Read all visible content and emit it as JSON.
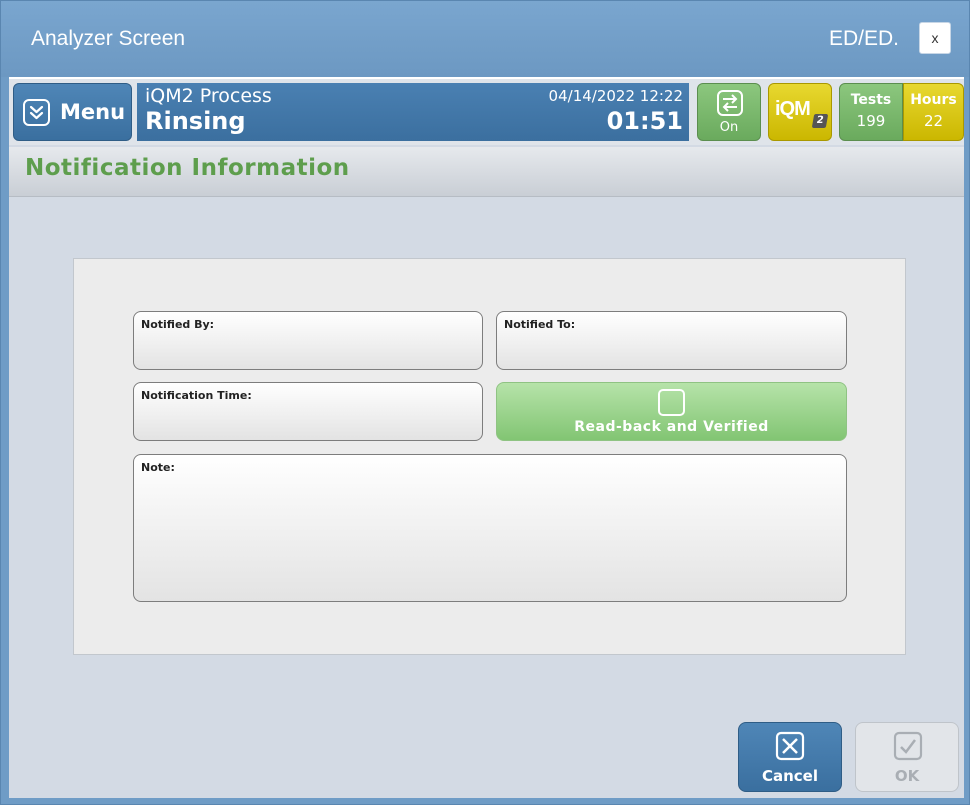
{
  "window": {
    "title": "Analyzer Screen",
    "user": "ED/ED.",
    "close_label": "x"
  },
  "statusbar": {
    "menu_label": "Menu",
    "menu_icon": "double-chevron-down-icon",
    "process_name": "iQM2 Process",
    "process_state": "Rinsing",
    "datetime": "04/14/2022 12:22",
    "timer": "01:51",
    "toggle_icon": "swap-arrows-icon",
    "toggle_label": "On",
    "iqm_label": "iQM",
    "iqm_sub": "2",
    "tests_label": "Tests",
    "tests_value": "199",
    "hours_label": "Hours",
    "hours_value": "22"
  },
  "section": {
    "title": "Notification Information"
  },
  "form": {
    "notified_by_label": "Notified By:",
    "notified_to_label": "Notified To:",
    "notification_time_label": "Notification Time:",
    "readback_label": "Read-back and Verified",
    "readback_checked": false,
    "note_label": "Note:"
  },
  "buttons": {
    "cancel_label": "Cancel",
    "ok_label": "OK",
    "ok_enabled": false
  },
  "colors": {
    "title_bar": "#6f9cc6",
    "accent_blue": "#3a6f9f",
    "accent_green": "#6aaa5d",
    "accent_yellow": "#cbb700",
    "section_title": "#5e9e4d"
  }
}
